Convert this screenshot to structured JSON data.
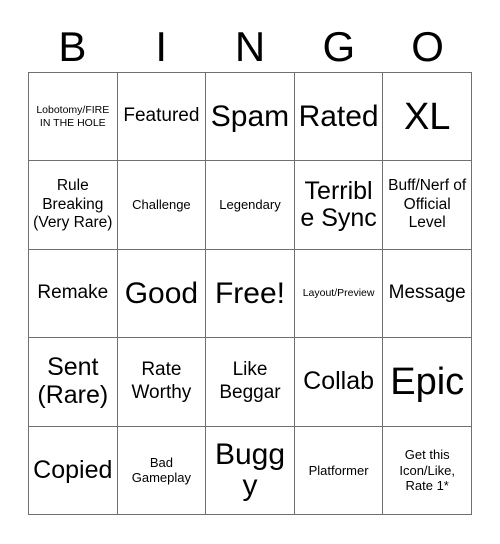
{
  "card": {
    "title_letters": [
      "B",
      "I",
      "N",
      "G",
      "O"
    ],
    "background_color": "#ffffff",
    "border_color": "#6f6f6f",
    "text_color": "#000000",
    "rows": 5,
    "columns": 5,
    "cells": [
      {
        "text": "Lobotomy/FIRE IN THE HOLE",
        "size": "fs-xs",
        "column": "B",
        "row": 1,
        "free": false
      },
      {
        "text": "Featured",
        "size": "fs-lg",
        "column": "I",
        "row": 1,
        "free": false
      },
      {
        "text": "Spam",
        "size": "fs-xxl",
        "column": "N",
        "row": 1,
        "free": false
      },
      {
        "text": "Rated",
        "size": "fs-xxl",
        "column": "G",
        "row": 1,
        "free": false
      },
      {
        "text": "XL",
        "size": "fs-huge",
        "column": "O",
        "row": 1,
        "free": false
      },
      {
        "text": "Rule Breaking (Very Rare)",
        "size": "fs-md",
        "column": "B",
        "row": 2,
        "free": false
      },
      {
        "text": "Challenge",
        "size": "fs-sm",
        "column": "I",
        "row": 2,
        "free": false
      },
      {
        "text": "Legendary",
        "size": "fs-sm",
        "column": "N",
        "row": 2,
        "free": false
      },
      {
        "text": "Terrible Sync",
        "size": "fs-xl",
        "column": "G",
        "row": 2,
        "free": false
      },
      {
        "text": "Buff/Nerf of Official Level",
        "size": "fs-md",
        "column": "O",
        "row": 2,
        "free": false
      },
      {
        "text": "Remake",
        "size": "fs-lg",
        "column": "B",
        "row": 3,
        "free": false
      },
      {
        "text": "Good",
        "size": "fs-xxl",
        "column": "I",
        "row": 3,
        "free": false
      },
      {
        "text": "Free!",
        "size": "fs-xxl",
        "column": "N",
        "row": 3,
        "free": true
      },
      {
        "text": "Layout/Preview",
        "size": "fs-xs",
        "column": "G",
        "row": 3,
        "free": false
      },
      {
        "text": "Message",
        "size": "fs-lg",
        "column": "O",
        "row": 3,
        "free": false
      },
      {
        "text": "Sent (Rare)",
        "size": "fs-xl",
        "column": "B",
        "row": 4,
        "free": false
      },
      {
        "text": "Rate Worthy",
        "size": "fs-lg",
        "column": "I",
        "row": 4,
        "free": false
      },
      {
        "text": "Like Beggar",
        "size": "fs-lg",
        "column": "N",
        "row": 4,
        "free": false
      },
      {
        "text": "Collab",
        "size": "fs-xl",
        "column": "G",
        "row": 4,
        "free": false
      },
      {
        "text": "Epic",
        "size": "fs-huge",
        "column": "O",
        "row": 4,
        "free": false
      },
      {
        "text": "Copied",
        "size": "fs-xl",
        "column": "B",
        "row": 5,
        "free": false
      },
      {
        "text": "Bad Gameplay",
        "size": "fs-sm",
        "column": "I",
        "row": 5,
        "free": false
      },
      {
        "text": "Buggy",
        "size": "fs-xxl",
        "column": "N",
        "row": 5,
        "free": false
      },
      {
        "text": "Platformer",
        "size": "fs-sm",
        "column": "G",
        "row": 5,
        "free": false
      },
      {
        "text": "Get this Icon/Like, Rate 1*",
        "size": "fs-sm",
        "column": "O",
        "row": 5,
        "free": false
      }
    ]
  }
}
